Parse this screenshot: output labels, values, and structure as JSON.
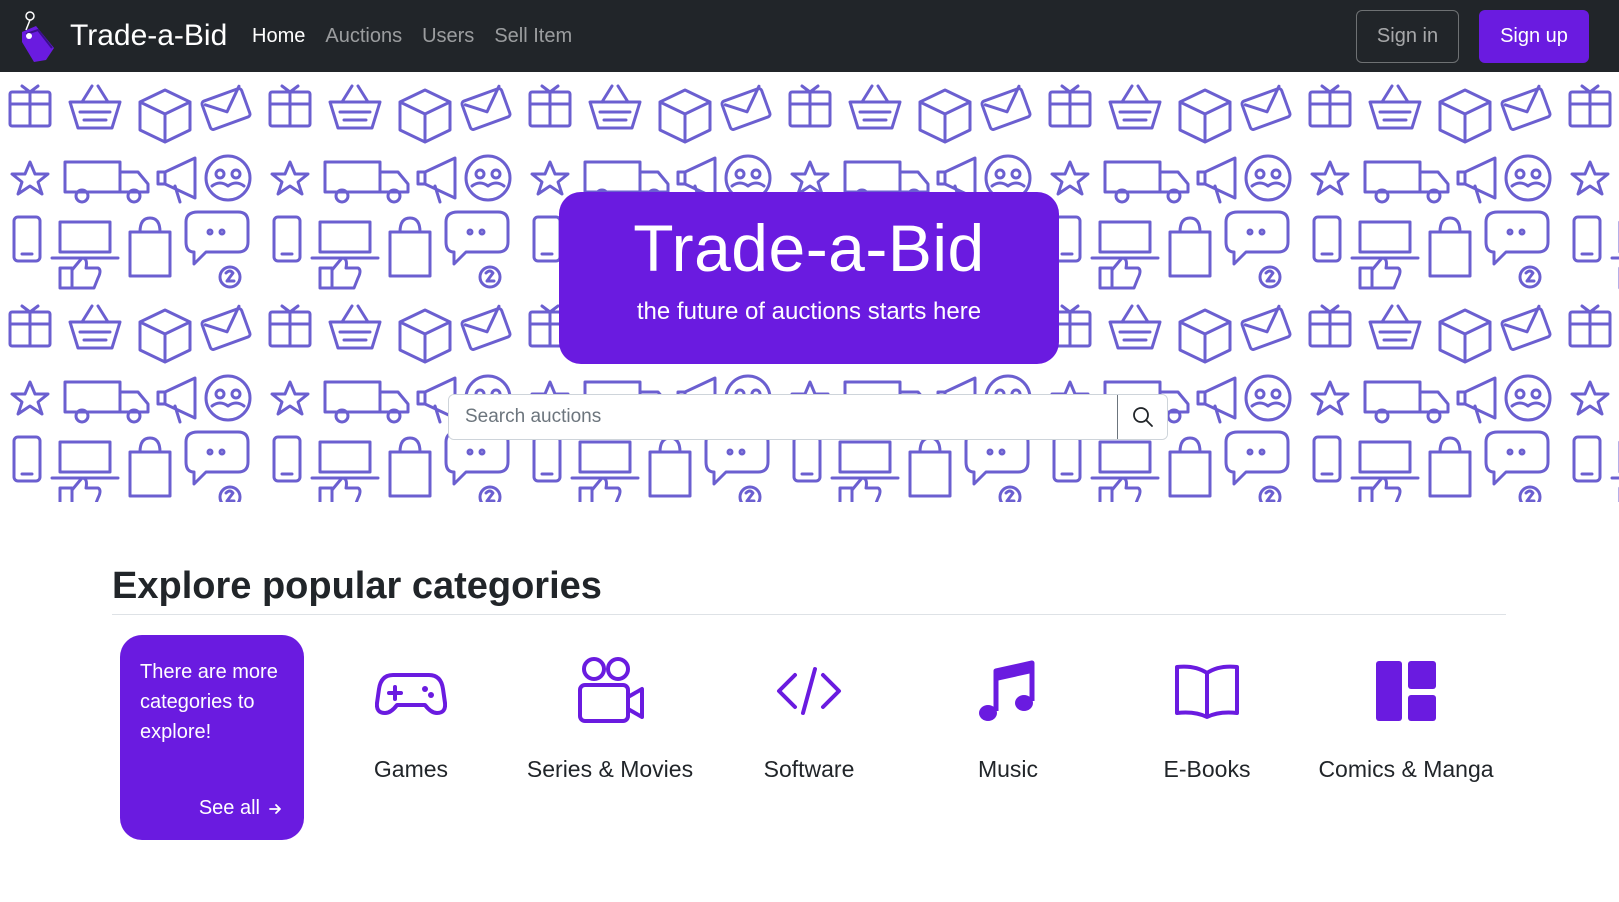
{
  "brand": {
    "name": "Trade-a-Bid"
  },
  "nav": {
    "links": [
      {
        "label": "Home",
        "active": true
      },
      {
        "label": "Auctions",
        "active": false
      },
      {
        "label": "Users",
        "active": false
      },
      {
        "label": "Sell Item",
        "active": false
      }
    ],
    "sign_in": "Sign in",
    "sign_up": "Sign up"
  },
  "hero": {
    "title": "Trade-a-Bid",
    "subtitle": "the future of auctions starts here",
    "search_placeholder": "Search auctions"
  },
  "categories": {
    "heading": "Explore popular categories",
    "more_text": "There are more categories to explore!",
    "see_all": "See all",
    "items": [
      {
        "label": "Games",
        "icon": "gamepad-icon"
      },
      {
        "label": "Series & Movies",
        "icon": "video-camera-icon"
      },
      {
        "label": "Software",
        "icon": "code-icon"
      },
      {
        "label": "Music",
        "icon": "music-note-icon"
      },
      {
        "label": "E-Books",
        "icon": "open-book-icon"
      },
      {
        "label": "Comics & Manga",
        "icon": "layout-panels-icon"
      }
    ]
  },
  "colors": {
    "navbar_bg": "#212529",
    "accent": "#6a1be0",
    "pattern": "#6b5fd0"
  }
}
